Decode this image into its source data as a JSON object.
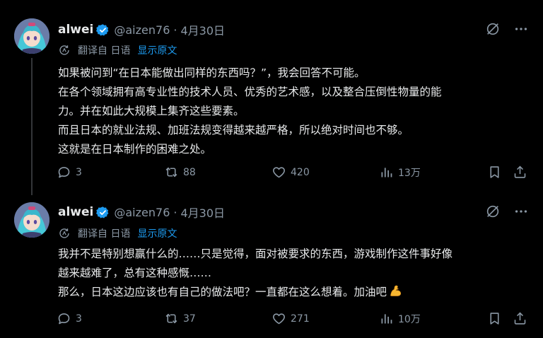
{
  "posts": [
    {
      "author": {
        "name": "alwei",
        "handle": "@aizen76",
        "separator": "·",
        "date": "4月30日"
      },
      "translation": {
        "label": "翻译自 日语",
        "link": "显示原文"
      },
      "lines": [
        "如果被问到“在日本能做出同样的东西吗？”，我会回答不可能。",
        "在各个领域拥有高专业性的技术人员、优秀的艺术感，以及整合压倒性物量的能",
        "力。并在如此大规模上集齐这些要素。",
        "而且日本的就业法规、加班法规变得越来越严格，所以绝对时间也不够。",
        "这就是在日本制作的困难之处。"
      ],
      "stats": {
        "replies": "3",
        "reposts": "88",
        "likes": "420",
        "views": "13万"
      }
    },
    {
      "author": {
        "name": "alwei",
        "handle": "@aizen76",
        "separator": "·",
        "date": "4月30日"
      },
      "translation": {
        "label": "翻译自 日语",
        "link": "显示原文"
      },
      "lines": [
        "我并不是特别想赢什么的……只是觉得，面对被要求的东西，游戏制作这件事好像",
        "越来越难了，总有这种感慨……",
        "那么，日本这边应该也有自己的做法吧？一直都在这么想着。加油吧"
      ],
      "stats": {
        "replies": "3",
        "reposts": "37",
        "likes": "271",
        "views": "10万"
      }
    }
  ],
  "icons": {
    "verified": "verified-badge-icon",
    "grok": "grok-icon",
    "more": "more-icon",
    "translate": "translate-icon",
    "reply": "reply-icon",
    "repost": "repost-icon",
    "like": "heart-icon",
    "views": "views-icon",
    "bookmark": "bookmark-icon",
    "share": "share-icon",
    "emoji": "flexed-biceps-emoji"
  },
  "colors": {
    "background": "#000000",
    "text": "#e7e9ea",
    "secondary": "#8b98a5",
    "link": "#1d9bf0",
    "verified": "#1d9bf0"
  }
}
